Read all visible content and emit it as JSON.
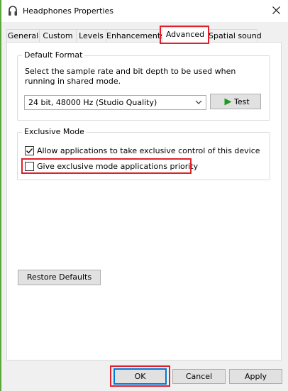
{
  "window": {
    "title": "Headphones Properties",
    "icon": "headphones-icon",
    "close_icon": "close-icon"
  },
  "tabs": [
    {
      "label": "General"
    },
    {
      "label": "Custom"
    },
    {
      "label": "Levels"
    },
    {
      "label": "Enhancements"
    },
    {
      "label": "Advanced",
      "active": true
    },
    {
      "label": "Spatial sound"
    }
  ],
  "default_format": {
    "title": "Default Format",
    "description": "Select the sample rate and bit depth to be used when running in shared mode.",
    "selected_format": "24 bit, 48000 Hz (Studio Quality)",
    "test_label": "Test",
    "test_icon": "play-icon"
  },
  "exclusive_mode": {
    "title": "Exclusive Mode",
    "allow_label": "Allow applications to take exclusive control of this device",
    "allow_checked": true,
    "priority_label": "Give exclusive mode applications priority",
    "priority_checked": false
  },
  "restore_defaults_label": "Restore Defaults",
  "footer": {
    "ok_label": "OK",
    "cancel_label": "Cancel",
    "apply_label": "Apply"
  },
  "colors": {
    "highlight": "#e0202a",
    "accent": "#0078d7",
    "play_green": "#1e9c1e"
  }
}
